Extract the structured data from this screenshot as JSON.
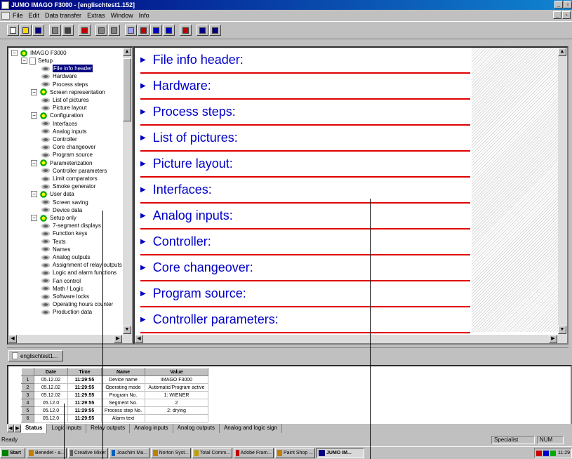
{
  "window": {
    "title": "JUMO IMAGO F3000 - [englischtest1.152]"
  },
  "menu": [
    {
      "label": "File",
      "ul": "F"
    },
    {
      "label": "Edit",
      "ul": "E"
    },
    {
      "label": "Data transfer",
      "ul": "D"
    },
    {
      "label": "Extras",
      "ul": "x"
    },
    {
      "label": "Window",
      "ul": "W"
    },
    {
      "label": "Info",
      "ul": "I"
    }
  ],
  "toolbar": {
    "icons": [
      "new-file-icon",
      "open-folder-icon",
      "save-icon",
      "print-preview-icon",
      "print-icon",
      "magic-icon",
      "undo-icon",
      "redo-icon",
      "edit-icon",
      "settings-icon",
      "prev-icon",
      "next-icon",
      "tool-icon",
      "view-a-icon",
      "view-b-icon"
    ]
  },
  "tree": {
    "root": "IMAGO F3000",
    "items": [
      {
        "label": "Setup",
        "level": 1,
        "type": "folder"
      },
      {
        "label": "File info header",
        "level": 2,
        "type": "leaf",
        "selected": true
      },
      {
        "label": "Hardware",
        "level": 2,
        "type": "leaf"
      },
      {
        "label": "Process steps",
        "level": 2,
        "type": "leaf"
      },
      {
        "label": "Screen representation",
        "level": 2,
        "type": "group"
      },
      {
        "label": "List of pictures",
        "level": 3,
        "type": "leaf"
      },
      {
        "label": "Picture layout",
        "level": 3,
        "type": "leaf"
      },
      {
        "label": "Configuration",
        "level": 2,
        "type": "group"
      },
      {
        "label": "Interfaces",
        "level": 3,
        "type": "leaf"
      },
      {
        "label": "Analog inputs",
        "level": 3,
        "type": "leaf"
      },
      {
        "label": "Controller",
        "level": 3,
        "type": "leaf"
      },
      {
        "label": "Core changeover",
        "level": 3,
        "type": "leaf"
      },
      {
        "label": "Program source",
        "level": 3,
        "type": "leaf"
      },
      {
        "label": "Parameterization",
        "level": 2,
        "type": "group"
      },
      {
        "label": "Controller parameters",
        "level": 3,
        "type": "leaf"
      },
      {
        "label": "Limit comparators",
        "level": 3,
        "type": "leaf"
      },
      {
        "label": "Smoke generator",
        "level": 3,
        "type": "leaf"
      },
      {
        "label": "User data",
        "level": 2,
        "type": "group"
      },
      {
        "label": "Screen saving",
        "level": 3,
        "type": "leaf"
      },
      {
        "label": "Device data",
        "level": 3,
        "type": "leaf"
      },
      {
        "label": "Setup only",
        "level": 2,
        "type": "group"
      },
      {
        "label": "7-segment displays",
        "level": 3,
        "type": "leaf"
      },
      {
        "label": "Function keys",
        "level": 3,
        "type": "leaf"
      },
      {
        "label": "Texts",
        "level": 3,
        "type": "leaf"
      },
      {
        "label": "Names",
        "level": 3,
        "type": "leaf"
      },
      {
        "label": "Analog outputs",
        "level": 3,
        "type": "leaf"
      },
      {
        "label": "Assignment of relay outputs",
        "level": 3,
        "type": "leaf"
      },
      {
        "label": "Logic and alarm functions",
        "level": 3,
        "type": "leaf"
      },
      {
        "label": "Fan control",
        "level": 3,
        "type": "leaf"
      },
      {
        "label": "Math / Logic",
        "level": 3,
        "type": "leaf"
      },
      {
        "label": "Software locks",
        "level": 3,
        "type": "leaf"
      },
      {
        "label": "Operating hours counter",
        "level": 3,
        "type": "leaf"
      },
      {
        "label": "Production data",
        "level": 3,
        "type": "leaf"
      }
    ]
  },
  "sections": [
    "File info header:",
    "Hardware:",
    "Process steps:",
    "List of pictures:",
    "Picture layout:",
    "Interfaces:",
    "Analog inputs:",
    "Controller:",
    "Core changeover:",
    "Program source:",
    "Controller parameters:"
  ],
  "doc_tab": {
    "label": "englischtest1..."
  },
  "grid": {
    "headers": [
      "Date",
      "Time",
      "Name",
      "Value"
    ],
    "rows": [
      {
        "n": "1",
        "date": "05.12.02",
        "time": "11:29:55",
        "name": "Device name",
        "value": "IMAGO F3000"
      },
      {
        "n": "2",
        "date": "05.12.02",
        "time": "11:29:55",
        "name": "Operating mode",
        "value": "Automatic/Program active"
      },
      {
        "n": "3",
        "date": "05.12.02",
        "time": "11:29:55",
        "name": "Program No.",
        "value": "1: WIENER"
      },
      {
        "n": "4",
        "date": "05.12.0",
        "time": "11:29:55",
        "name": "Segment No.",
        "value": "2"
      },
      {
        "n": "5",
        "date": "05.12.0",
        "time": "11:29:55",
        "name": "Process step No.",
        "value": "2: drying"
      },
      {
        "n": "6",
        "date": "05.12.0",
        "time": "11:29:55",
        "name": "Alarm text",
        "value": ""
      }
    ]
  },
  "sheet_tabs": [
    "Status",
    "Logic inputs",
    "Relay outputs",
    "Analog inputs",
    "Analog outputs",
    "Analog and logic sign"
  ],
  "statusbar": {
    "left": "Ready",
    "mode": "Specialist",
    "num": "NUM"
  },
  "taskbar": {
    "start": "Start",
    "items": [
      "Benedet - a...",
      "Creative Mixer",
      "Joachim Ma...",
      "Norton Syst...",
      "Total Comm...",
      "Adobe Fram...",
      "Paint Shop ...",
      "JUMO IM..."
    ],
    "active": 7,
    "clock": "11:29"
  }
}
